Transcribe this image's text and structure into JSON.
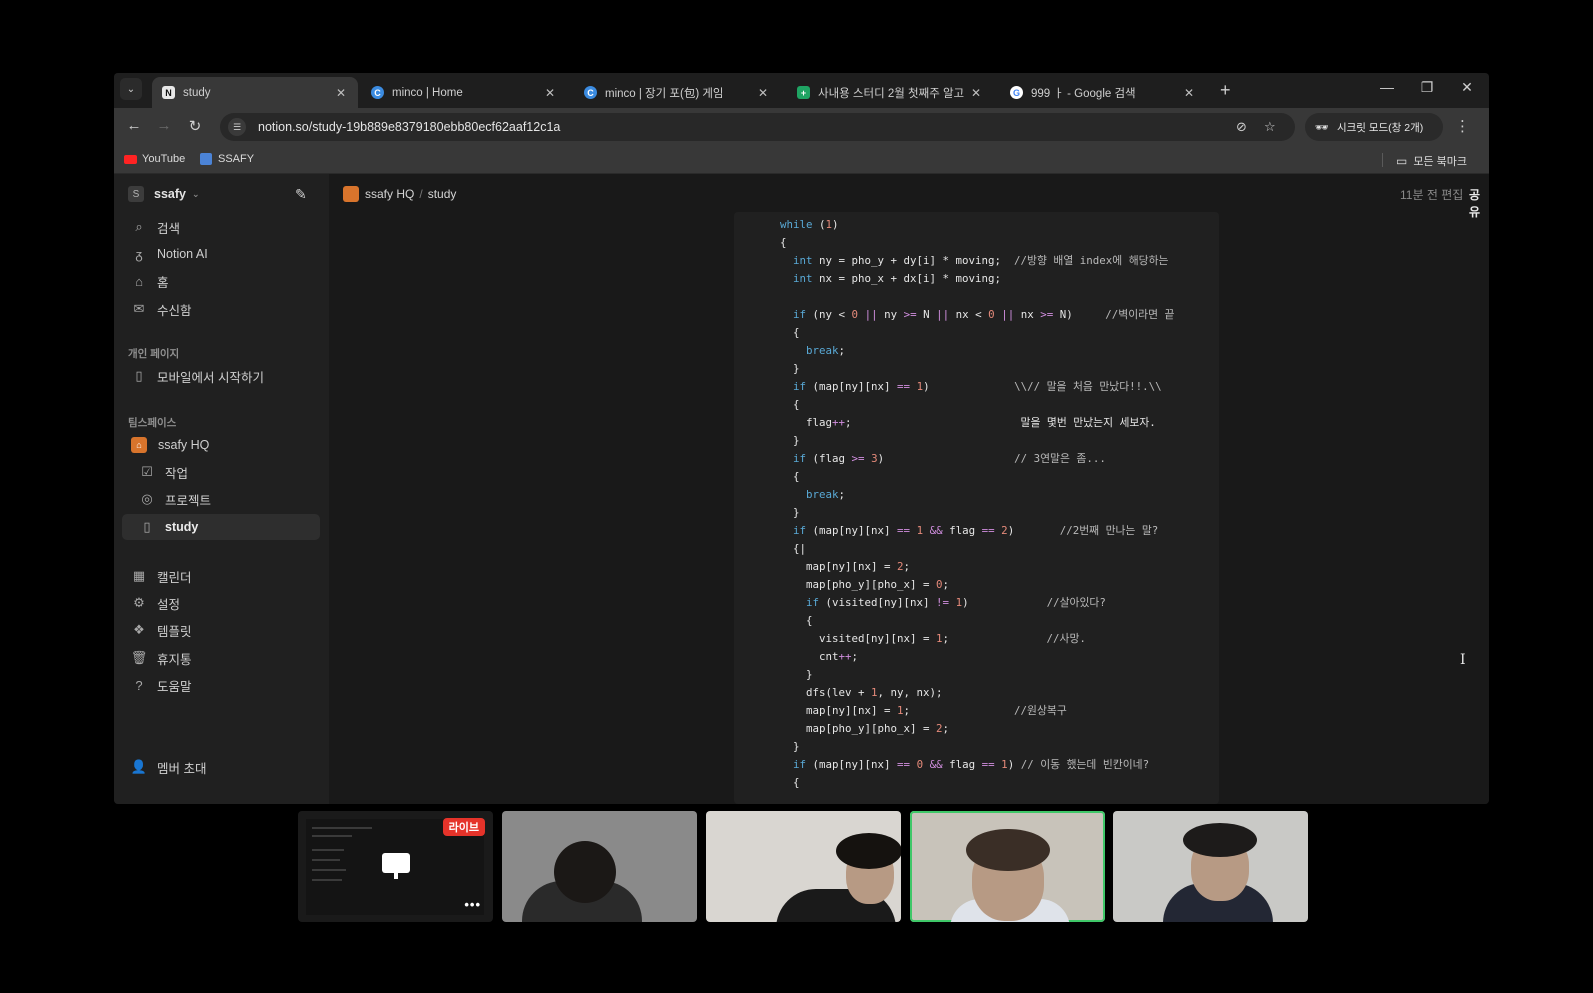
{
  "browser": {
    "tabs": [
      {
        "title": "study",
        "favicon": "notion-icon",
        "active": true
      },
      {
        "title": "minco | Home",
        "favicon": "minco-icon",
        "active": false
      },
      {
        "title": "minco | 장기 포(包) 게임",
        "favicon": "minco-icon",
        "active": false
      },
      {
        "title": "사내용 스터디 2월 첫째주 알고",
        "favicon": "sheets-icon",
        "active": false
      },
      {
        "title": "999 ㅏ - Google 검색",
        "favicon": "google-icon",
        "active": false
      }
    ],
    "url": "notion.so/study-19b889e8379180ebb80ecf62aaf12c1a",
    "incognito_label": "시크릿 모드(창 2개)",
    "bookmarks": [
      {
        "label": "YouTube"
      },
      {
        "label": "SSAFY"
      }
    ],
    "all_bookmarks_label": "모든 북마크"
  },
  "sidebar": {
    "workspace_initial": "S",
    "workspace_name": "ssafy",
    "top_items": [
      {
        "label": "검색",
        "icon": "search-icon"
      },
      {
        "label": "Notion AI",
        "icon": "notion-ai-icon"
      },
      {
        "label": "홈",
        "icon": "home-icon"
      },
      {
        "label": "수신함",
        "icon": "inbox-icon"
      }
    ],
    "private_section": "개인 페이지",
    "private_items": [
      {
        "label": "모바일에서 시작하기",
        "icon": "page-icon"
      }
    ],
    "team_section": "팀스페이스",
    "team_items": [
      {
        "label": "ssafy HQ",
        "icon": "hq-icon"
      },
      {
        "label": "작업",
        "icon": "checkbox-icon"
      },
      {
        "label": "프로젝트",
        "icon": "target-icon"
      },
      {
        "label": "study",
        "icon": "page-icon"
      }
    ],
    "bottom_items": [
      {
        "label": "캘린더",
        "icon": "calendar-icon"
      },
      {
        "label": "설정",
        "icon": "gear-icon"
      },
      {
        "label": "템플릿",
        "icon": "template-icon"
      },
      {
        "label": "휴지통",
        "icon": "trash-icon"
      },
      {
        "label": "도움말",
        "icon": "help-icon"
      }
    ],
    "invite_label": "멤버 초대"
  },
  "page": {
    "breadcrumb": [
      "ssafy HQ",
      "study"
    ],
    "edited": "11분 전 편집",
    "share": "공유"
  },
  "code_lines": [
    "while (1)",
    "{",
    "  int ny = pho_y + dy[i] * moving;  //방향 배열 index에 해당하는",
    "  int nx = pho_x + dx[i] * moving;",
    "",
    "  if (ny < 0 || ny >= N || nx < 0 || nx >= N)     //벽이라면 끝",
    "  {",
    "    break;",
    "  }",
    "  if (map[ny][nx] == 1)             \\\\// 말을 처음 만났다!!.\\\\",
    "  {",
    "    flag++;                          말을 몇번 만났는지 세보자.",
    "  }",
    "  if (flag >= 3)                    // 3연말은 좀...",
    "  {",
    "    break;",
    "  }",
    "  if (map[ny][nx] == 1 && flag == 2)       //2번째 만나는 말?",
    "  {|",
    "    map[ny][nx] = 2;",
    "    map[pho_y][pho_x] = 0;",
    "    if (visited[ny][nx] != 1)            //살아있다?",
    "    {",
    "      visited[ny][nx] = 1;               //사망.",
    "      cnt++;",
    "    }",
    "    dfs(lev + 1, ny, nx);",
    "    map[ny][nx] = 1;                //원상복구",
    "    map[pho_y][pho_x] = 2;",
    "  }",
    "  if (map[ny][nx] == 0 && flag == 1) // 이동 했는데 빈칸이네?",
    "  {"
  ],
  "call": {
    "live_badge": "라이브"
  }
}
